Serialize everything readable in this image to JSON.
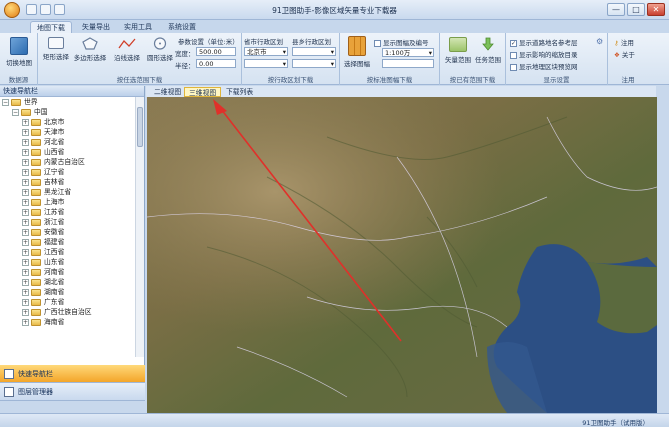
{
  "window": {
    "title": "91卫图助手-影像区域矢量专业下载器",
    "controls": [
      "—",
      "□",
      "✕"
    ]
  },
  "tabs": [
    "地图下载",
    "矢量导出",
    "实用工具",
    "系统设置"
  ],
  "ribbon": {
    "g1": {
      "label": "数据源",
      "button": "切换地图"
    },
    "g2": {
      "label": "按任选范围下载",
      "buttons": [
        "矩形选择",
        "多边形选择",
        "沿线选择",
        "圆形选择"
      ],
      "params_title": "参数设置（单位:米）",
      "width_label": "宽度：",
      "width_value": "500.00",
      "radius_label": "半径：",
      "radius_value": "0.00"
    },
    "g3": {
      "label": "按行政区划下载",
      "province_label": "省市行政区划",
      "province_value": "北京市",
      "county_label": "县乡行政区划",
      "county_value": ""
    },
    "g4": {
      "label": "按标准图幅下载",
      "button": "选择图幅",
      "check_label": "显示图幅及编号",
      "scale_value": "1:100万"
    },
    "g5": {
      "label": "按已有范围下载",
      "buttons": [
        "矢量范围",
        "任务范围"
      ]
    },
    "g6": {
      "label": "显示设置",
      "checks": [
        {
          "label": "显示道路地名参考层",
          "checked": true
        },
        {
          "label": "显示影响的缩放目录",
          "checked": false
        },
        {
          "label": "显示地理区块预览网",
          "checked": false
        }
      ]
    },
    "g7": {
      "label": "注用",
      "buttons": [
        "注用",
        "关于"
      ]
    }
  },
  "sidebar": {
    "title": "快速导航栏",
    "root": "世界",
    "country": "中国",
    "provinces": [
      "北京市",
      "天津市",
      "河北省",
      "山西省",
      "内蒙古自治区",
      "辽宁省",
      "吉林省",
      "黑龙江省",
      "上海市",
      "江苏省",
      "浙江省",
      "安徽省",
      "福建省",
      "江西省",
      "山东省",
      "河南省",
      "湖北省",
      "湖南省",
      "广东省",
      "广西壮族自治区",
      "海南省"
    ],
    "nav_buttons": [
      "快速导航栏",
      "图层管理器"
    ]
  },
  "map_tabs": [
    "二维视图",
    "三维视图",
    "下载列表"
  ],
  "statusbar": {
    "text": "91卫图助手（试用版）"
  },
  "colors": {
    "accent": "#f3a52a",
    "ribbon": "#d5e2f1",
    "arrow": "#e0302a",
    "sea": "#2c4f84"
  }
}
